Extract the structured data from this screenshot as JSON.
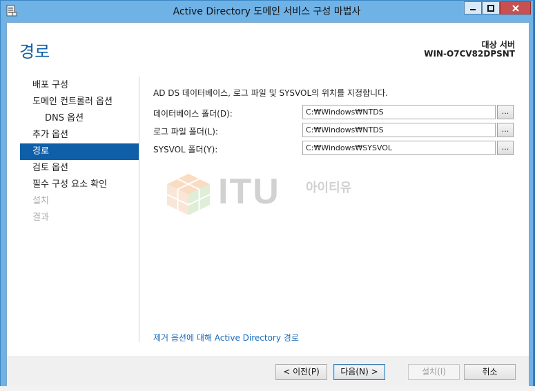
{
  "window": {
    "title": "Active Directory 도메인 서비스 구성 마법사",
    "accent_color": "#6fb2e6",
    "close_color": "#c75050"
  },
  "header": {
    "page_title": "경로",
    "server_label": "대상 서버",
    "server_name": "WIN-O7CV82DPSNT"
  },
  "nav": {
    "items": [
      {
        "label": "배포 구성"
      },
      {
        "label": "도메인 컨트롤러 옵션"
      },
      {
        "label": "DNS 옵션"
      },
      {
        "label": "추가 옵션"
      },
      {
        "label": "경로"
      },
      {
        "label": "검토 옵션"
      },
      {
        "label": "필수 구성 요소 확인"
      },
      {
        "label": "설치"
      },
      {
        "label": "결과"
      }
    ]
  },
  "content": {
    "instruction": "AD DS 데이터베이스, 로그 파일 및 SYSVOL의 위치를 지정합니다.",
    "fields": [
      {
        "label": "데이터베이스 폴더(D):",
        "value": "C:₩Windows₩NTDS"
      },
      {
        "label": "로그 파일 폴더(L):",
        "value": "C:₩Windows₩NTDS"
      },
      {
        "label": "SYSVOL 폴더(Y):",
        "value": "C:₩Windows₩SYSVOL"
      }
    ],
    "browse_label": "...",
    "link": "제거 옵션에 대해 Active Directory 경로"
  },
  "watermark": {
    "text": "ITU",
    "sub": "아이티유"
  },
  "footer": {
    "prev": "< 이전(P)",
    "next": "다음(N) >",
    "install": "설치(I)",
    "cancel": "취소"
  }
}
